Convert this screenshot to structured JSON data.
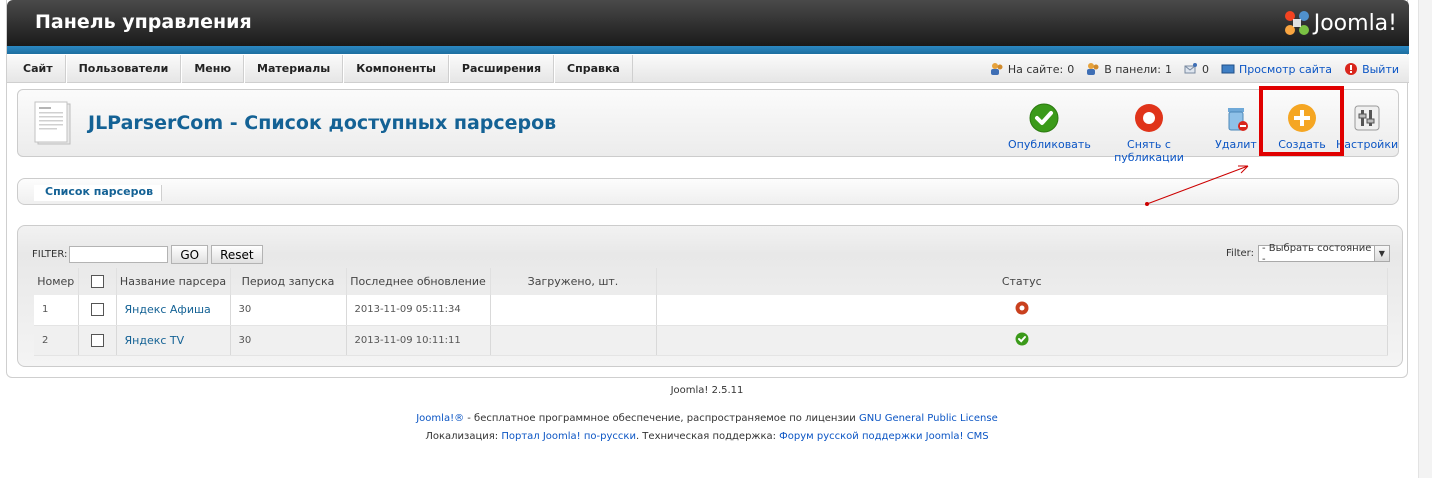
{
  "header": {
    "title": "Панель управления",
    "logo_text": "Joomla!"
  },
  "menu": {
    "items": [
      "Сайт",
      "Пользователи",
      "Меню",
      "Материалы",
      "Компоненты",
      "Расширения",
      "Справка"
    ]
  },
  "status": {
    "on_site_label": "На сайте:",
    "on_site_count": "0",
    "in_panel_label": "В панели:",
    "in_panel_count": "1",
    "messages_count": "0",
    "view_site": "Просмотр сайта",
    "logout": "Выйти"
  },
  "toolbar": {
    "page_title": "JLParserCom - Список доступных парсеров",
    "publish": "Опубликовать",
    "unpublish": "Снять с публикации",
    "delete": "Удалит",
    "create": "Создать",
    "settings": "Настройки"
  },
  "submenu": {
    "tab": "Список парсеров"
  },
  "filter": {
    "label": "FILTER:",
    "value": "",
    "go": "GO",
    "reset": "Reset",
    "state_label": "Filter:",
    "state_selected": "- Выбрать состояние -"
  },
  "table": {
    "columns": [
      "Номер",
      "",
      "Название парсера",
      "Период запуска",
      "Последнее обновление",
      "Загружено, шт.",
      "Статус"
    ],
    "rows": [
      {
        "num": "1",
        "name": "Яндекс Афиша",
        "period": "30",
        "updated": "2013-11-09 05:11:34",
        "loaded": "",
        "status": "unpublished"
      },
      {
        "num": "2",
        "name": "Яндекс TV",
        "period": "30",
        "updated": "2013-11-09 10:11:11",
        "loaded": "",
        "status": "published"
      }
    ]
  },
  "footer": {
    "version": "Joomla! 2.5.11",
    "license_link": "Joomla!®",
    "license_text": " - бесплатное программное обеспечение, распространяемое по лицензии ",
    "gpl_link": "GNU General Public License",
    "loc_label": "Локализация: ",
    "loc_link": "Портал Joomla! по-русски",
    "support_label": ". Техническая поддержка: ",
    "support_link": "Форум русской поддержки Joomla! CMS"
  },
  "colors": {
    "accent_blue": "#146295",
    "link_blue": "#0b55c4",
    "highlight_red": "#e00000",
    "publish_green": "#3b9a1a",
    "unpublish_red": "#e0341a",
    "create_orange": "#f5a623"
  }
}
